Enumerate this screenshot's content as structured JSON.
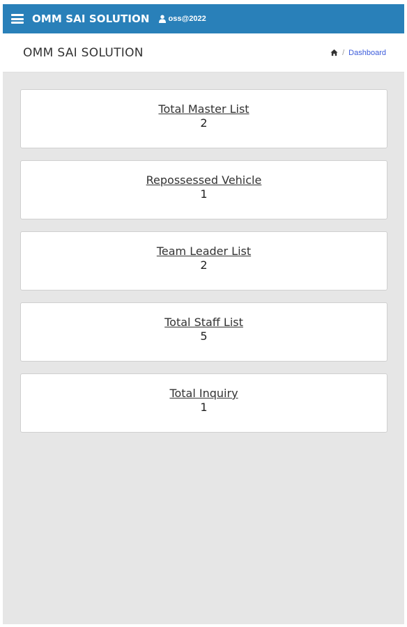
{
  "header": {
    "brand": "OMM SAI SOLUTION",
    "user": "oss@2022"
  },
  "subheader": {
    "title": "OMM SAI SOLUTION",
    "breadcrumb_separator": "/",
    "breadcrumb_current": "Dashboard"
  },
  "cards": [
    {
      "title": "Total Master List",
      "count": "2"
    },
    {
      "title": "Repossessed Vehicle",
      "count": "1"
    },
    {
      "title": "Team Leader List",
      "count": "2"
    },
    {
      "title": "Total Staff List",
      "count": "5"
    },
    {
      "title": "Total Inquiry",
      "count": "1"
    }
  ],
  "colors": {
    "topbar": "#2980b9",
    "background": "#e6e6e6",
    "link": "#3b5bdb"
  },
  "icons": {
    "menu": "hamburger-icon",
    "user": "user-icon",
    "home": "home-icon"
  }
}
